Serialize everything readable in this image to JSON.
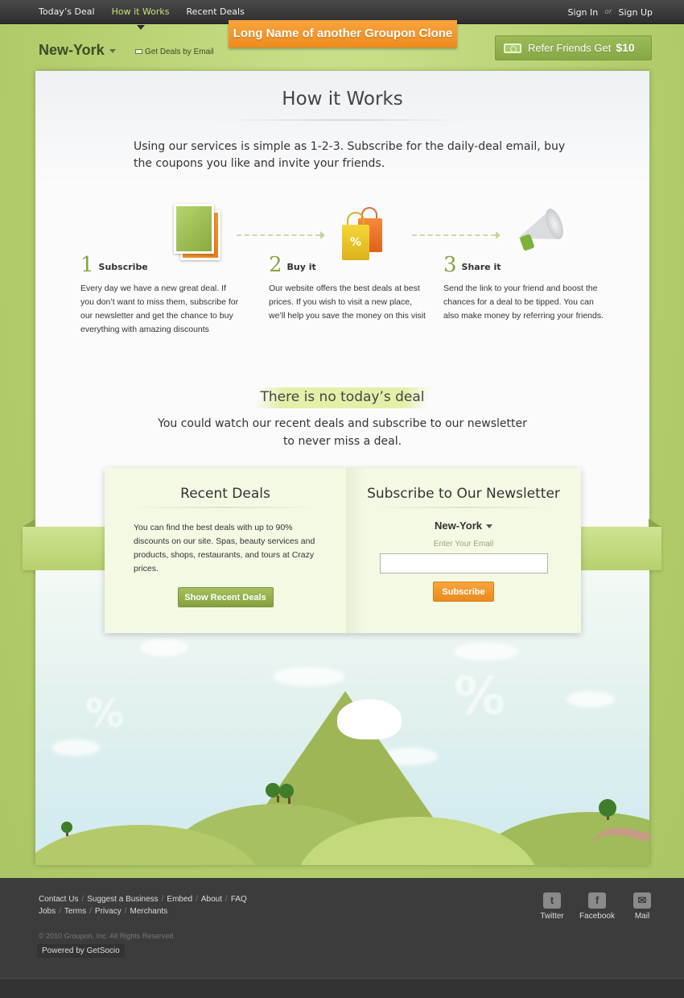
{
  "nav": {
    "items": [
      "Today’s Deal",
      "How it Works",
      "Recent Deals"
    ],
    "active_index": 1
  },
  "auth": {
    "sign_in": "Sign In",
    "or": "or",
    "sign_up": "Sign Up"
  },
  "site_title": "Long Name of another Groupon Clone",
  "city_selector": {
    "city": "New-York"
  },
  "get_deals_email": "Get Deals by Email",
  "refer": {
    "label": "Refer Friends Get",
    "amount": "$10"
  },
  "how": {
    "title": "How it Works",
    "intro": "Using our services is simple as 1-2-3. Subscribe for the daily-deal email, buy the coupons you like and invite your friends.",
    "steps": [
      {
        "num": "1",
        "title": "Subscribe",
        "desc": "Every day we have a new great deal. If you don’t want to miss them, subscribe for our newsletter and get the chance to buy everything with amazing discounts"
      },
      {
        "num": "2",
        "title": "Buy it",
        "desc": "Our website offers the best deals at best prices. If you wish to visit a new place, we’ll help you save the money on this visit"
      },
      {
        "num": "3",
        "title": "Share it",
        "desc": "Send the link to your friend and boost the chances for a deal to be tipped. You can also make money by referring your friends."
      }
    ]
  },
  "no_deal": {
    "title": "There is no today’s deal",
    "text_line1": "You could watch our recent deals and subscribe to our newsletter",
    "text_line2": "to never miss a deal."
  },
  "recent": {
    "title": "Recent Deals",
    "text": "You can find the best deals with up to 90% discounts on our site. Spas, beauty services and products, shops, restaurants, and tours at Crazy prices.",
    "button": "Show Recent Deals"
  },
  "newsletter": {
    "title": "Subscribe to Our Newsletter",
    "city": "New-York",
    "email_label": "Enter Your Email",
    "email_value": "",
    "button": "Subscribe"
  },
  "footer": {
    "links_row1": [
      "Contact Us",
      "Suggest a Business",
      "Embed",
      "About",
      "FAQ"
    ],
    "links_row2": [
      "Jobs",
      "Terms",
      "Privacy",
      "Merchants"
    ],
    "copyright": "© 2010 Groupon, Inc. All Rights Reserved.",
    "powered": "Powered by GetSocio",
    "social": [
      {
        "label": "Twitter",
        "icon": "twitter-icon"
      },
      {
        "label": "Facebook",
        "icon": "facebook-icon"
      },
      {
        "label": "Mail",
        "icon": "mail-icon"
      }
    ]
  },
  "colors": {
    "accent_green": "#8aa441",
    "accent_orange": "#ef8b1f",
    "topbar": "#2e2e2e",
    "footer": "#3c3c3c"
  }
}
